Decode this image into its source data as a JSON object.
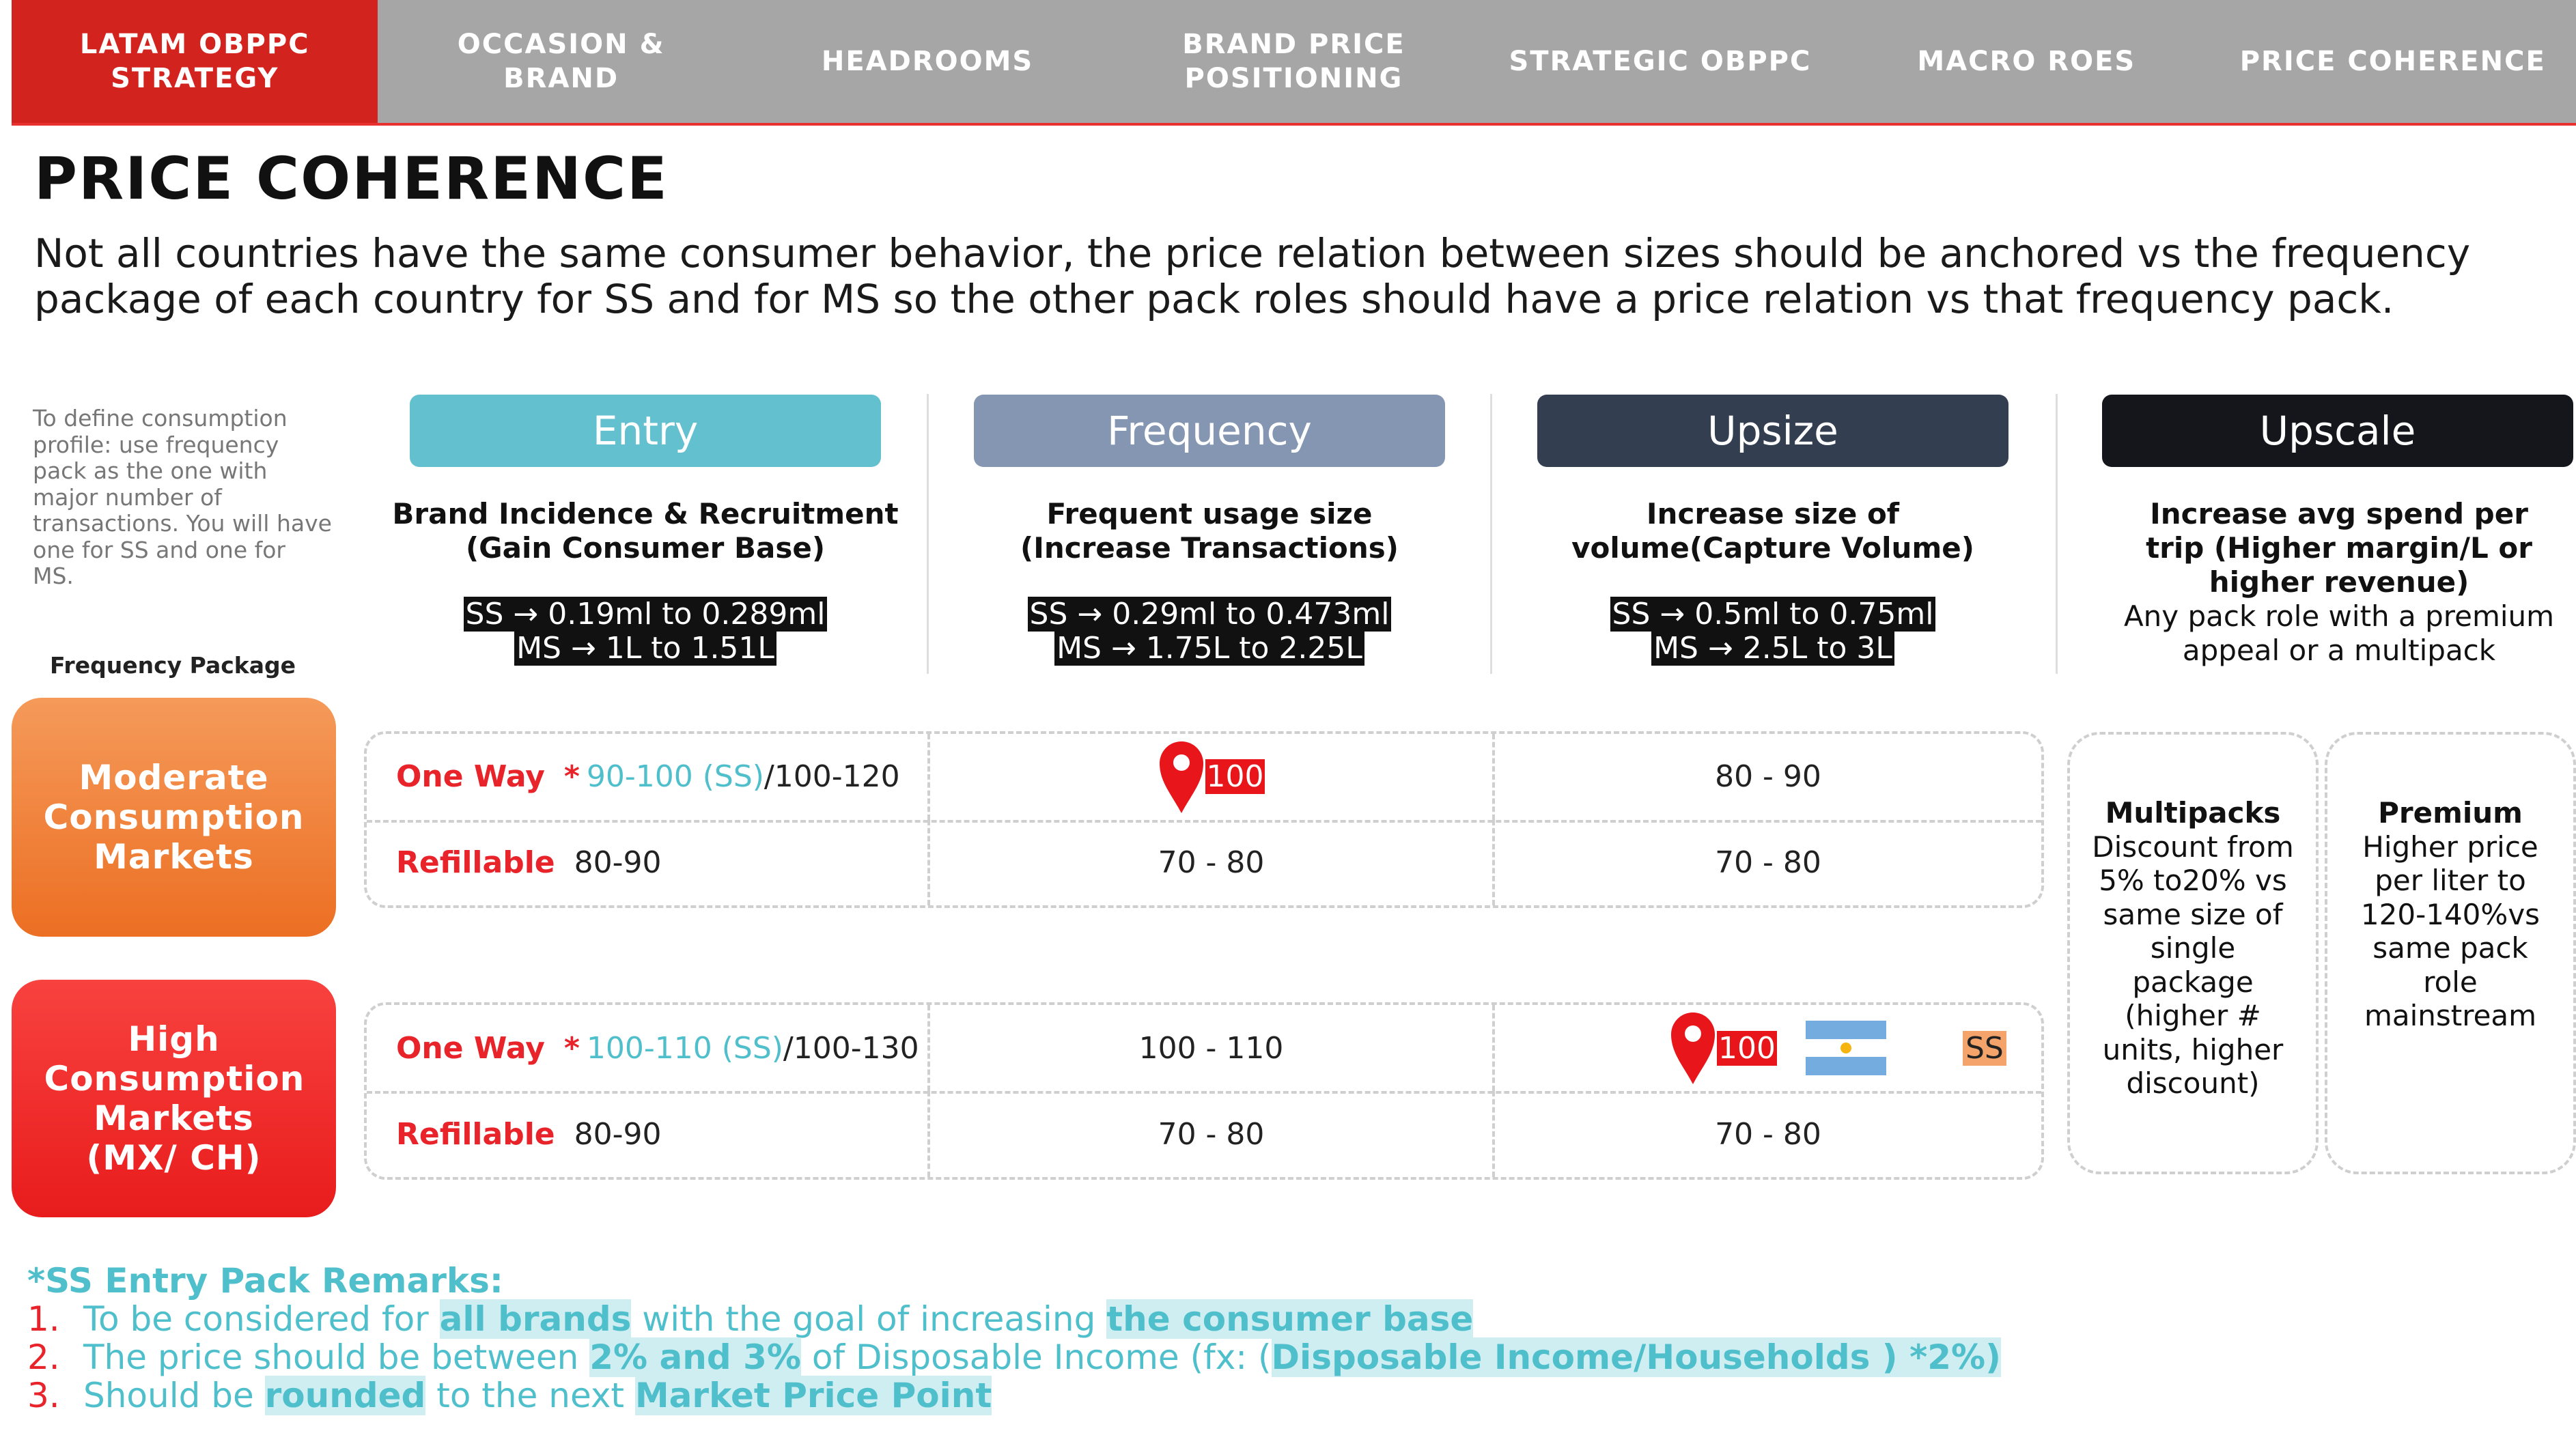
{
  "nav": {
    "tabs": [
      {
        "label": "LATAM OBPPC\nSTRATEGY",
        "active": true
      },
      {
        "label": "OCCASION &\nBRAND",
        "active": false
      },
      {
        "label": "HEADROOMS",
        "active": false
      },
      {
        "label": "BRAND PRICE\nPOSITIONING",
        "active": false
      },
      {
        "label": "STRATEGIC OBPPC",
        "active": false
      },
      {
        "label": "MACRO ROES",
        "active": false
      },
      {
        "label": "PRICE COHERENCE",
        "active": false
      }
    ]
  },
  "page": {
    "title": "PRICE COHERENCE",
    "subtitle": "Not all countries have the same consumer behavior, the price relation between sizes should be anchored vs the frequency package of each country for SS and for MS so the other pack roles should have a price relation vs that frequency pack."
  },
  "side_note": "To define consumption profile: use frequency pack as the one with major number of transactions. You will have one for SS and one for MS.",
  "frequency_package_label": "Frequency Package",
  "columns": [
    {
      "name": "Entry",
      "color": "#63c0cf",
      "desc1": "Brand Incidence & Recruitment",
      "desc2": "(Gain Consumer Base)",
      "ss": "SS → 0.19ml to 0.289ml",
      "ms": "MS → 1L to 1.51L"
    },
    {
      "name": "Frequency",
      "color": "#8496b2",
      "desc1": "Frequent usage size",
      "desc2": "(Increase Transactions)",
      "ss": "SS → 0.29ml to 0.473ml",
      "ms": "MS → 1.75L to 2.25L"
    },
    {
      "name": "Upsize",
      "color": "#333f50",
      "desc1": "Increase size of",
      "desc2": "volume(Capture Volume)",
      "ss": "SS → 0.5ml to 0.75ml",
      "ms": "MS → 2.5L to 3L"
    },
    {
      "name": "Upscale",
      "color": "#15151c",
      "desc1": "Increase avg spend per trip (Higher margin/L or higher revenue)",
      "desc2": "Any pack role with a premium appeal or a multipack"
    }
  ],
  "markets": {
    "moderate": {
      "label": "Moderate Consumption Markets",
      "one_way": {
        "label": "One Way",
        "star": "*",
        "entry_ss": "90-100 (SS)",
        "entry_rest": "/100-120",
        "frequency": "100",
        "upsize": "80 - 90"
      },
      "refillable": {
        "label": "Refillable",
        "entry": "80-90",
        "frequency": "70 - 80",
        "upsize": "70 - 80"
      }
    },
    "high": {
      "label": "High Consumption Markets (MX/ CH)",
      "one_way": {
        "label": "One Way",
        "star": "*",
        "entry_ss": "100-110 (SS)",
        "entry_rest": "/100-130",
        "frequency": "100 - 110",
        "upsize": "100",
        "upsize_tag": "SS"
      },
      "refillable": {
        "label": "Refillable",
        "entry": "80-90",
        "frequency": "70 - 80",
        "upsize": "70 - 80"
      }
    }
  },
  "upscale_cards": [
    {
      "title": "Multipacks",
      "text": "Discount from 5% to20% vs same size of single package (higher # units, higher discount)"
    },
    {
      "title": "Premium",
      "text": "Higher price per liter to 120-140%vs same pack role mainstream"
    }
  ],
  "remarks": {
    "title": "*SS Entry Pack Remarks:",
    "items": [
      {
        "num": "1.",
        "parts": [
          [
            "To be considered for ",
            false
          ],
          [
            "all brands",
            true
          ],
          [
            " with the goal of increasing ",
            false
          ],
          [
            "the consumer base",
            true
          ]
        ]
      },
      {
        "num": "2.",
        "parts": [
          [
            "The price should be between ",
            false
          ],
          [
            "2% and 3%",
            true
          ],
          [
            " of Disposable Income (fx: (",
            false
          ],
          [
            "Disposable Income/Households ) *2%)",
            true
          ]
        ]
      },
      {
        "num": "3.",
        "parts": [
          [
            "Should be ",
            false
          ],
          [
            "rounded",
            true
          ],
          [
            " to the next ",
            false
          ],
          [
            "Market Price Point",
            true
          ]
        ]
      }
    ]
  }
}
